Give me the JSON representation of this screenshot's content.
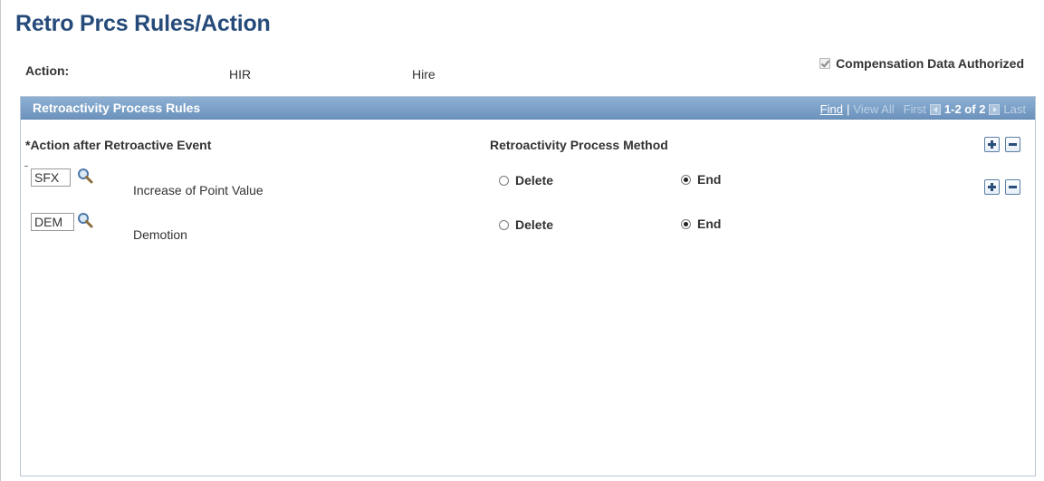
{
  "page": {
    "title": "Retro Prcs Rules/Action"
  },
  "header": {
    "action_label": "Action:",
    "action_code": "HIR",
    "action_desc": "Hire",
    "comp_auth_label": "Compensation Data Authorized",
    "comp_auth_checked": true
  },
  "grid": {
    "title": "Retroactivity Process Rules",
    "nav": {
      "find": "Find",
      "separator": "|",
      "view_all": "View All",
      "first": "First",
      "count": "1-2 of 2",
      "last": "Last"
    },
    "columns": {
      "action": "*Action after Retroactive Event",
      "method": "Retroactivity Process Method"
    },
    "rows": [
      {
        "code": "SFX",
        "description": "Increase of Point Value",
        "option_delete": "Delete",
        "option_end": "End",
        "selected": "End"
      },
      {
        "code": "DEM",
        "description": "Demotion",
        "option_delete": "Delete",
        "option_end": "End",
        "selected": "End"
      }
    ]
  },
  "colors": {
    "title": "#264b7a",
    "grid_header": "#7ba0c8"
  },
  "icons": {
    "lookup": "magnifier-icon",
    "add_row": "plus-icon",
    "delete_row": "minus-icon"
  }
}
